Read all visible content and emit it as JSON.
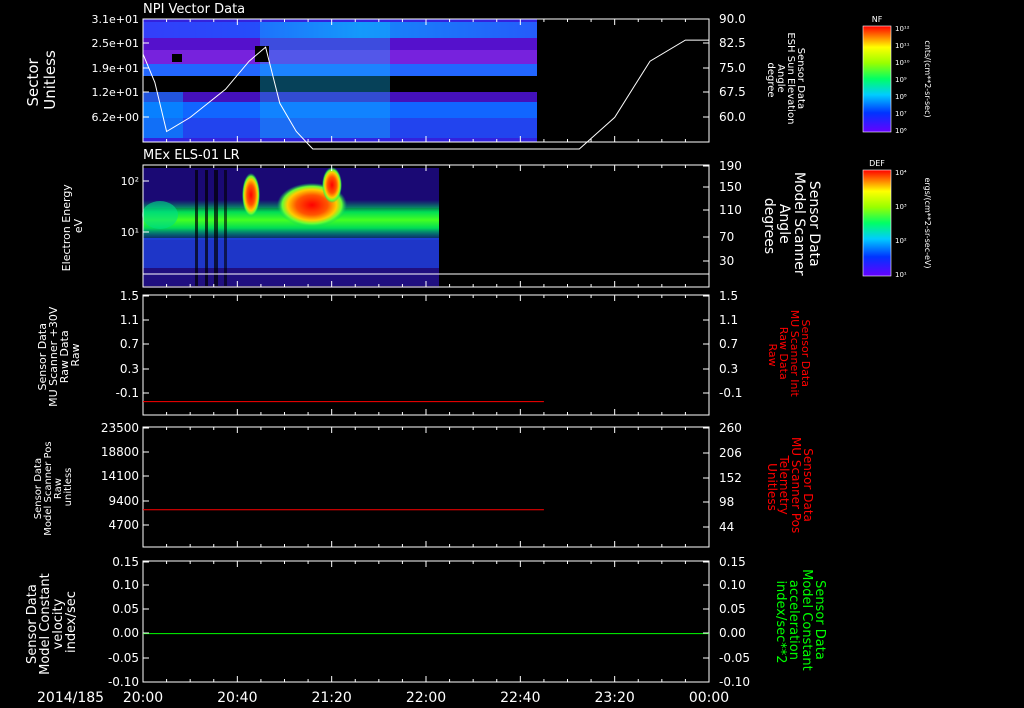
{
  "date_label": "2014/185",
  "x_ticks": [
    "20:00",
    "20:40",
    "21:20",
    "22:00",
    "22:40",
    "23:20",
    "00:00"
  ],
  "colors": {
    "axis": "#ffffff",
    "red": "#ff0000",
    "green": "#00ff00"
  },
  "panels": {
    "p1": {
      "title": "NPI Vector Data",
      "left_label": [
        "Sector",
        "Unitless"
      ],
      "left_ticks": [
        "3.1e+01",
        "2.5e+01",
        "1.9e+01",
        "1.2e+01",
        "6.2e+00"
      ],
      "right_label": [
        "Sensor Data",
        "ESH Sun Elevation",
        "Angle",
        "degree"
      ],
      "right_ticks": [
        "90.0",
        "82.5",
        "75.0",
        "67.5",
        "60.0"
      ]
    },
    "p2": {
      "title": "MEx ELS-01 LR",
      "left_label": [
        "Electron Energy",
        "eV"
      ],
      "left_ticks": [
        "10²",
        "10¹"
      ],
      "right_label": [
        "Sensor Data",
        "Model Scanner",
        "Angle",
        "degrees"
      ],
      "right_ticks": [
        "190",
        "150",
        "110",
        "70",
        "30"
      ]
    },
    "p3": {
      "left_label": [
        "Sensor Data",
        "MU Scanner +30V",
        "Raw Data",
        "Raw"
      ],
      "left_ticks": [
        "1.5",
        "1.1",
        "0.7",
        "0.3",
        "-0.1"
      ],
      "right_label": [
        "Sensor Data",
        "MU Scanner Init",
        "Raw Data",
        "Raw"
      ],
      "right_ticks": [
        "1.5",
        "1.1",
        "0.7",
        "0.3",
        "-0.1"
      ]
    },
    "p4": {
      "left_label": [
        "Sensor Data",
        "Model Scanner Pos",
        "Raw",
        "unitless"
      ],
      "left_ticks": [
        "23500",
        "18800",
        "14100",
        "9400",
        "4700"
      ],
      "right_label": [
        "Sensor Data",
        "MU Scanner Pos",
        "Telemetry",
        "Unitless"
      ],
      "right_ticks": [
        "260",
        "206",
        "152",
        "98",
        "44"
      ]
    },
    "p5": {
      "left_label": [
        "Sensor Data",
        "Model Constant",
        "velocity",
        "index/sec"
      ],
      "left_ticks": [
        "0.15",
        "0.10",
        "0.05",
        "0.00",
        "-0.05",
        "-0.10"
      ],
      "right_label": [
        "Sensor Data",
        "Model Constant",
        "acceleration",
        "index/sec**2"
      ],
      "right_ticks": [
        "0.15",
        "0.10",
        "0.05",
        "0.00",
        "-0.05",
        "-0.10"
      ]
    }
  },
  "colorbars": {
    "cb1": {
      "title": "NF",
      "unit": "cnts/(cm**2-sr-sec)",
      "ticks": [
        "10¹²",
        "10¹¹",
        "10¹⁰",
        "10⁹",
        "10⁸",
        "10⁷",
        "10⁶"
      ]
    },
    "cb2": {
      "title": "DEF",
      "unit": "ergs/(cm**2-sr-sec-eV)",
      "ticks": [
        "10⁴",
        "10³",
        "10²",
        "10¹"
      ]
    }
  },
  "chart_data": [
    {
      "type": "heatmap",
      "title": "NPI Vector Data",
      "ylabel": "Sector Unitless",
      "xlim": [
        "20:00",
        "00:00"
      ],
      "data_end_time": "22:47",
      "overlay_line": {
        "name": "ESH Sun Elevation Angle",
        "ylabel": "degree",
        "ylim": [
          55,
          90
        ],
        "times": [
          "20:00",
          "20:05",
          "20:10",
          "20:20",
          "20:35",
          "20:45",
          "20:52",
          "20:58",
          "21:05",
          "21:12",
          "23:05",
          "23:20",
          "23:35",
          "23:50",
          "00:00"
        ],
        "values": [
          80,
          72,
          58,
          62,
          70,
          78,
          82,
          66,
          58,
          53,
          53,
          62,
          78,
          84,
          84
        ]
      }
    },
    {
      "type": "heatmap",
      "title": "MEx ELS-01 LR",
      "ylabel": "Electron Energy eV",
      "xlim": [
        "20:00",
        "00:00"
      ],
      "data_end_time": "22:05",
      "overlay_line": {
        "name": "Model Scanner Angle",
        "ylabel": "degrees",
        "values": [
          10
        ],
        "ylim": [
          0,
          190
        ]
      }
    },
    {
      "type": "line",
      "ylim": [
        -0.3,
        1.5
      ],
      "series": [
        {
          "name": "MU Scanner +30V Raw Data",
          "times": [
            "20:00",
            "22:50"
          ],
          "values": [
            -0.1,
            -0.1
          ]
        }
      ]
    },
    {
      "type": "line",
      "ylim": [
        0,
        23500
      ],
      "series": [
        {
          "name": "Model Scanner Pos Raw",
          "times": [
            "20:00",
            "22:50"
          ],
          "values": [
            7300,
            7300
          ]
        }
      ]
    },
    {
      "type": "line",
      "ylim": [
        -0.1,
        0.15
      ],
      "series": [
        {
          "name": "Model Constant velocity",
          "times": [
            "20:00",
            "00:00"
          ],
          "values": [
            0.0,
            0.0
          ]
        }
      ]
    }
  ]
}
